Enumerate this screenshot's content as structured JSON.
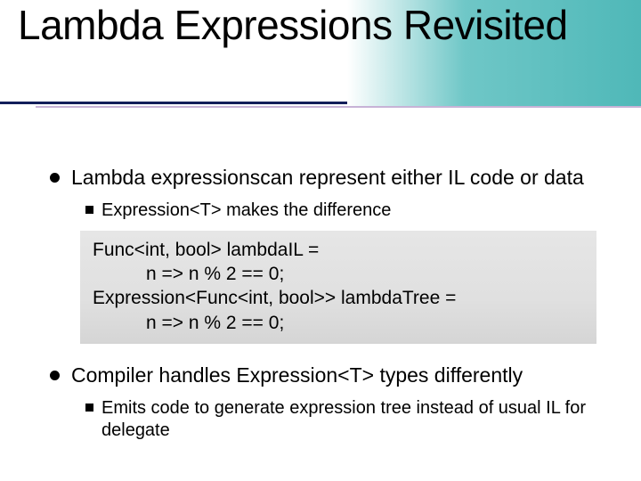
{
  "title": "Lambda Expressions Revisited",
  "bullets": [
    {
      "text": "Lambda expressionscan represent either IL code or data",
      "sub": [
        "Expression<T> makes the difference"
      ]
    },
    {
      "text": "Compiler handles Expression<T> types differently",
      "sub": [
        "Emits code to generate expression tree instead of usual IL for delegate"
      ]
    }
  ],
  "code": {
    "l1": "Func<int, bool> lambdaIL =",
    "l2": "n => n % 2 == 0;",
    "l3": "Expression<Func<int, bool>> lambdaTree =",
    "l4": "n => n % 2 == 0;"
  }
}
